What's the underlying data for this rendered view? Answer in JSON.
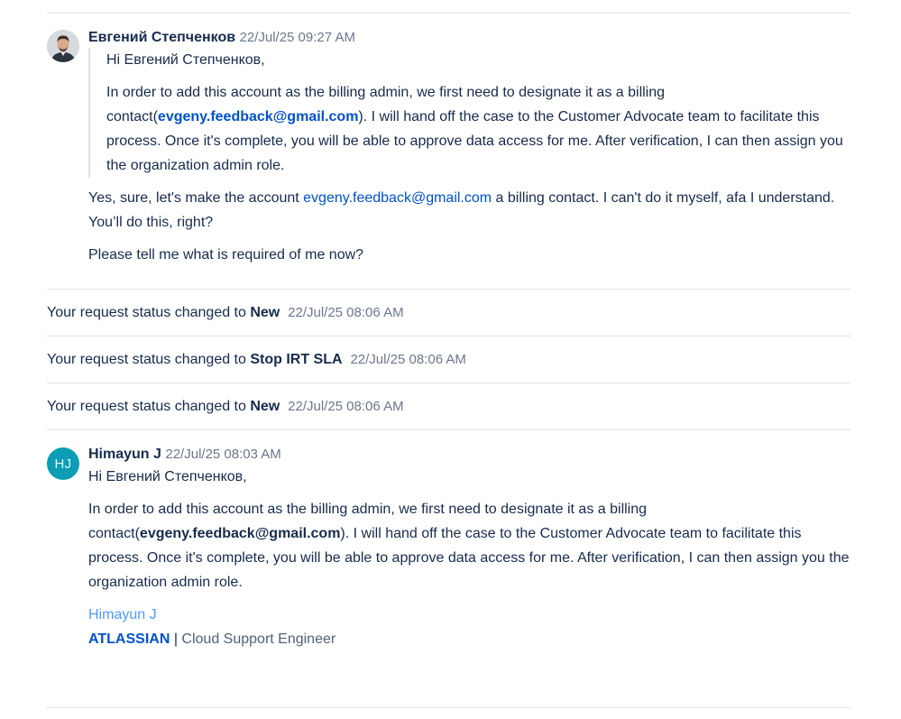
{
  "comment1": {
    "author": "Евгений Степченков",
    "timestamp": "22/Jul/25 09:27 AM",
    "quote": {
      "greeting": "Hi Евгений Степченков,",
      "para_before_email": "In order to add this account as the billing admin, we first need to designate it as a billing contact(",
      "email": "evgeny.feedback@gmail.com",
      "para_after_email": "). I will hand off the case to the Customer Advocate team to facilitate this process. Once it's complete, you will be able to approve data access for me. After verification, I can then assign you the organization admin role."
    },
    "reply_before_email": "Yes, sure, let's make the account ",
    "reply_email": "evgeny.feedback@gmail.com",
    "reply_after_email": " a billing contact. I can't do it myself, afa I understand. You’ll do this, right?",
    "question": "Please tell me what is required of me now?"
  },
  "status_prefix": "Your request status changed to ",
  "status_changes": [
    {
      "status": "New",
      "timestamp": "22/Jul/25 08:06 AM"
    },
    {
      "status": "Stop IRT SLA",
      "timestamp": "22/Jul/25 08:06 AM"
    },
    {
      "status": "New",
      "timestamp": "22/Jul/25 08:06 AM"
    }
  ],
  "comment2": {
    "author": "Himayun J",
    "initials": "HJ",
    "timestamp": "22/Jul/25 08:03 AM",
    "greeting": "Hi Евгений Степченков,",
    "para_before_email": "In order to add this account as the billing admin, we first need to designate it as a billing contact(",
    "email": "evgeny.feedback@gmail.com",
    "para_after_email": "). I will hand off the case to the Customer Advocate team to facilitate this process. Once it's complete, you will be able to approve data access for me. After verification, I can then assign you the organization admin role.",
    "signature": {
      "name": "Himayun J",
      "company": "ATLASSIAN",
      "separator": " | ",
      "role": "Cloud Support Engineer"
    }
  },
  "colors": {
    "text": "#172b4d",
    "timestamp": "#6b778c",
    "link": "#0052cc",
    "divider": "#dfe1e6",
    "avatar_bg": "#0d9db5",
    "signature_name": "#4c9aff"
  }
}
